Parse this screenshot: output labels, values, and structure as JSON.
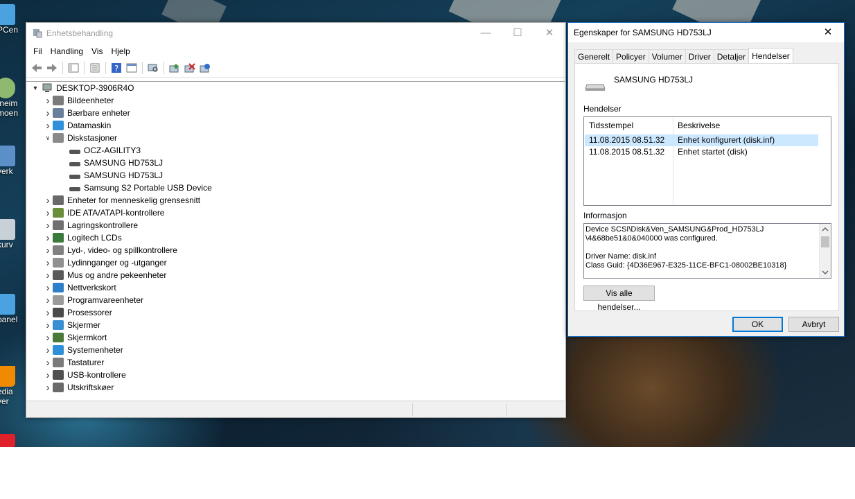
{
  "desktop": {
    "icons": [
      {
        "label": "PCen",
        "color": "#4aa3e0"
      },
      {
        "label": "tneim",
        "label2": "moen",
        "color": "#8fb96e"
      },
      {
        "label": "verk",
        "color": "#5a8fc8"
      },
      {
        "label": "kurv",
        "color": "#c8d0d8"
      },
      {
        "label": "panel",
        "color": "#4aa3e0"
      },
      {
        "label": "edia",
        "label2": "yer",
        "color": "#f08a00"
      }
    ]
  },
  "device_manager": {
    "title": "Enhetsbehandling",
    "menu": [
      "Fil",
      "Handling",
      "Vis",
      "Hjelp"
    ],
    "root": "DESKTOP-3906R4O",
    "categories": [
      {
        "label": "Bildeenheter",
        "icon_color": "#7a7a7a"
      },
      {
        "label": "Bærbare enheter",
        "icon_color": "#6a7f9a"
      },
      {
        "label": "Datamaskin",
        "icon_color": "#2f8fd8"
      },
      {
        "label": "Diskstasjoner",
        "icon_color": "#8a8a8a",
        "expanded": true,
        "children": [
          "OCZ-AGILITY3",
          "SAMSUNG HD753LJ",
          "SAMSUNG HD753LJ",
          "Samsung S2 Portable USB Device"
        ]
      },
      {
        "label": "Enheter for menneskelig grensesnitt",
        "icon_color": "#6a6a6a"
      },
      {
        "label": "IDE ATA/ATAPI-kontrollere",
        "icon_color": "#6b8e3b"
      },
      {
        "label": "Lagringskontrollere",
        "icon_color": "#707070"
      },
      {
        "label": "Logitech LCDs",
        "icon_color": "#3a7a3a"
      },
      {
        "label": "Lyd-, video- og spillkontrollere",
        "icon_color": "#808080"
      },
      {
        "label": "Lydinnganger og -utganger",
        "icon_color": "#909090"
      },
      {
        "label": "Mus og andre pekeenheter",
        "icon_color": "#5a5a5a"
      },
      {
        "label": "Nettverkskort",
        "icon_color": "#2f7fc8"
      },
      {
        "label": "Programvareenheter",
        "icon_color": "#9a9a9a"
      },
      {
        "label": "Prosessorer",
        "icon_color": "#4a4a4a"
      },
      {
        "label": "Skjermer",
        "icon_color": "#3a8fd0"
      },
      {
        "label": "Skjermkort",
        "icon_color": "#4a7a3a"
      },
      {
        "label": "Systemenheter",
        "icon_color": "#2f8fd8"
      },
      {
        "label": "Tastaturer",
        "icon_color": "#7a7a7a"
      },
      {
        "label": "USB-kontrollere",
        "icon_color": "#505050"
      },
      {
        "label": "Utskriftskøer",
        "icon_color": "#6a6a6a"
      }
    ]
  },
  "properties": {
    "title": "Egenskaper for SAMSUNG HD753LJ",
    "tabs": [
      "Generelt",
      "Policyer",
      "Volumer",
      "Driver",
      "Detaljer",
      "Hendelser"
    ],
    "active_tab": "Hendelser",
    "device_name": "SAMSUNG HD753LJ",
    "events_label": "Hendelser",
    "events_columns": [
      "Tidsstempel",
      "Beskrivelse"
    ],
    "events": [
      {
        "time": "11.08.2015 08.51.32",
        "desc": "Enhet konfigurert (disk.inf)",
        "selected": true
      },
      {
        "time": "11.08.2015 08.51.32",
        "desc": "Enhet startet (disk)",
        "selected": false
      }
    ],
    "info_label": "Informasjon",
    "info_lines": [
      "Device SCSI\\Disk&Ven_SAMSUNG&Prod_HD753LJ",
      "\\4&68be51&0&040000 was configured.",
      "",
      "Driver Name: disk.inf",
      "Class Guid: {4D36E967-E325-11CE-BFC1-08002BE10318}"
    ],
    "show_all_button": "Vis alle hendelser...",
    "ok_button": "OK",
    "cancel_button": "Avbryt"
  }
}
